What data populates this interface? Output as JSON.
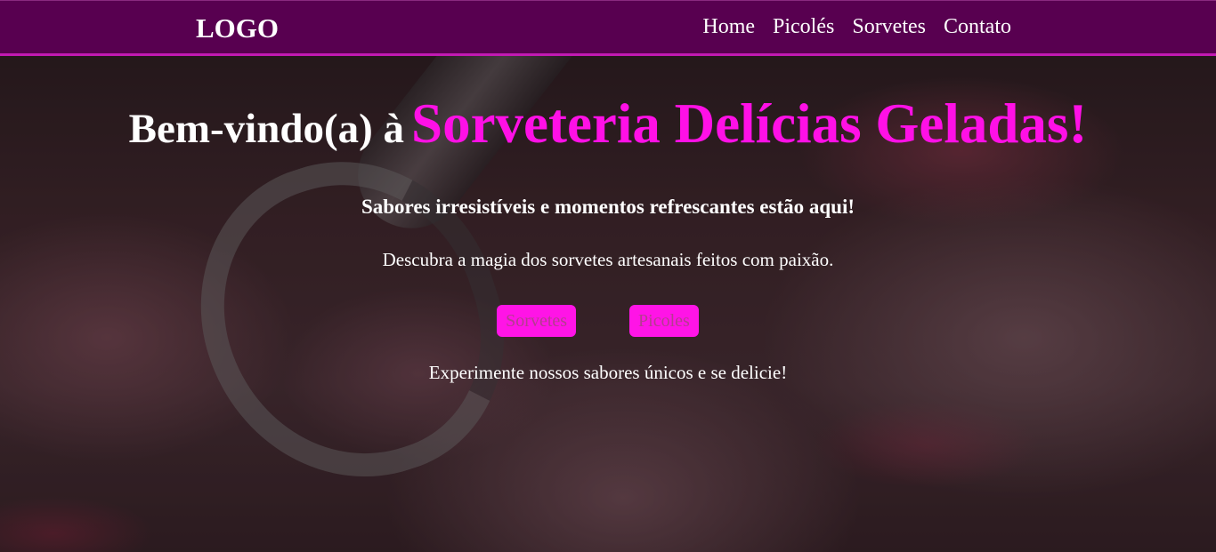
{
  "header": {
    "logo": "LOGO",
    "nav": [
      "Home",
      "Picolés",
      "Sorvetes",
      "Contato"
    ]
  },
  "hero": {
    "title_prefix": "Bem-vindo(a) à",
    "title_brand": "Sorveteria Delícias Geladas!",
    "subtitle": "Sabores irresistíveis e momentos refrescantes estão aqui!",
    "description": "Descubra a magia dos sorvetes artesanais feitos com paixão.",
    "buttons": [
      "Sorvetes",
      "Picoles"
    ],
    "tagline": "Experimente nossos sabores únicos e se delicie!"
  },
  "colors": {
    "header_bg": "#580050",
    "accent": "#ff10e6",
    "header_border": "#c21ab3"
  }
}
